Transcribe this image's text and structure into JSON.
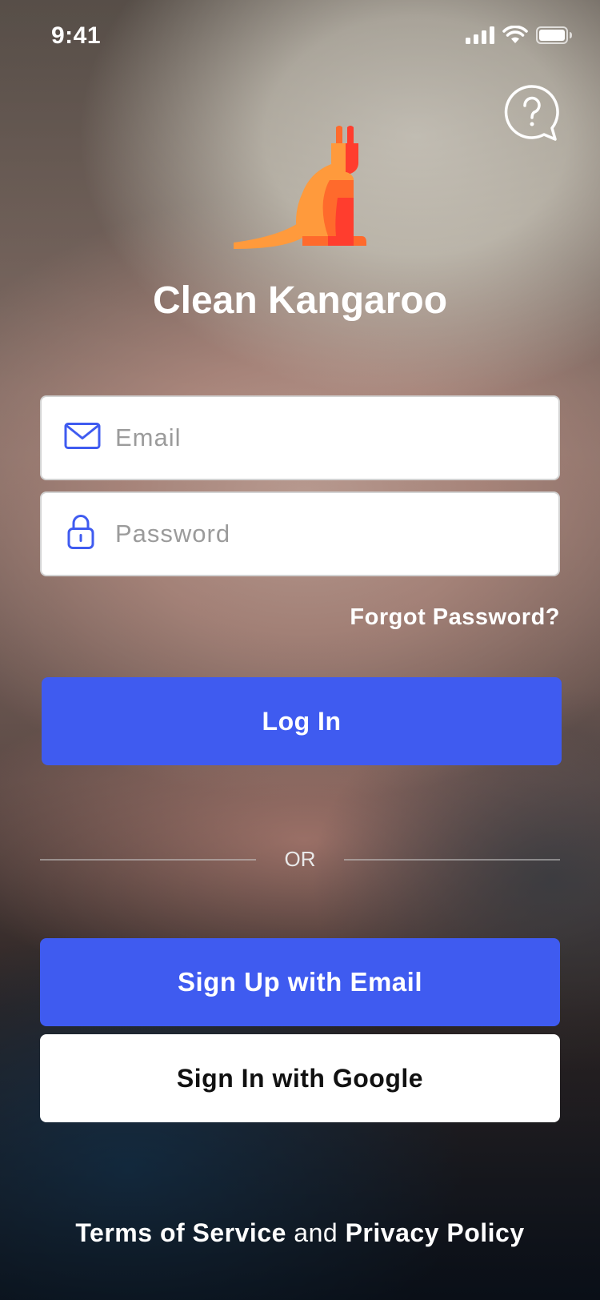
{
  "status_bar": {
    "time": "9:41",
    "icons": [
      "signal-icon",
      "wifi-icon",
      "battery-icon"
    ]
  },
  "help": {
    "icon": "help-question-icon"
  },
  "brand": {
    "logo": "kangaroo-logo",
    "name": "Clean Kangaroo",
    "logo_colors": [
      "#ff9a3c",
      "#ff6a2c",
      "#ff3d2e"
    ]
  },
  "form": {
    "email": {
      "placeholder": "Email",
      "value": "",
      "icon": "mail-icon"
    },
    "password": {
      "placeholder": "Password",
      "value": "",
      "icon": "lock-icon"
    },
    "forgot_label": "Forgot Password?",
    "login_label": "Log In"
  },
  "divider": {
    "label": "OR"
  },
  "signup": {
    "email_label": "Sign Up with Email",
    "google_label": "Sign In with Google"
  },
  "legal": {
    "terms": "Terms of Service",
    "and": "and",
    "privacy": "Privacy Policy"
  },
  "colors": {
    "accent": "#3f5bf0",
    "icon_blue": "#3f5bf0",
    "field_bg": "#ffffff"
  }
}
